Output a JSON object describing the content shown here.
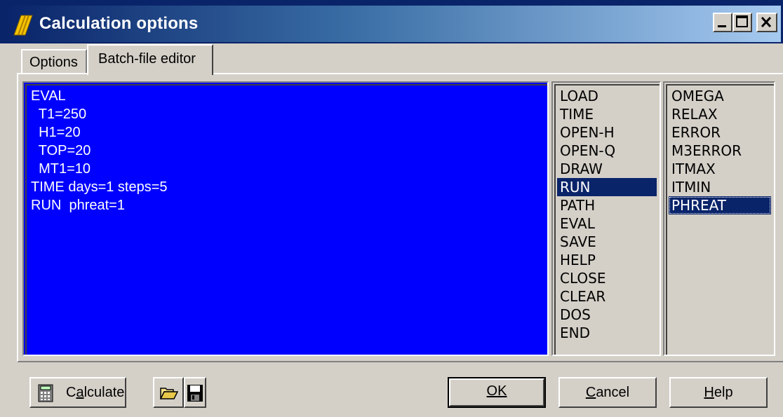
{
  "window": {
    "title": "Calculation options",
    "controls": [
      "minimize-icon",
      "maximize-icon",
      "close-icon"
    ]
  },
  "tabs": [
    {
      "label": "Options",
      "active": false
    },
    {
      "label": "Batch-file editor",
      "active": true
    }
  ],
  "editor": {
    "lines": [
      "EVAL",
      "  T1=250",
      "  H1=20",
      "  TOP=20",
      "  MT1=10",
      "TIME days=1 steps=5",
      "RUN  phreat=1"
    ]
  },
  "commands": {
    "items": [
      "LOAD",
      "TIME",
      "OPEN-H",
      "OPEN-Q",
      "DRAW",
      "RUN",
      "PATH",
      "EVAL",
      "SAVE",
      "HELP",
      "CLOSE",
      "CLEAR",
      "DOS",
      "END"
    ],
    "selected": "RUN"
  },
  "parameters": {
    "items": [
      "OMEGA",
      "RELAX",
      "ERROR",
      "M3ERROR",
      "ITMAX",
      "ITMIN",
      "PHREAT"
    ],
    "selected": "PHREAT"
  },
  "buttons": {
    "calculate_label": "Calculate",
    "calculate_accel": "a",
    "ok_label": "OK",
    "cancel_label": "Cancel",
    "help_label": "Help"
  },
  "colors": {
    "editor_bg": "#0000ff",
    "selection": "#0a246a",
    "face": "#d4d0c8"
  }
}
